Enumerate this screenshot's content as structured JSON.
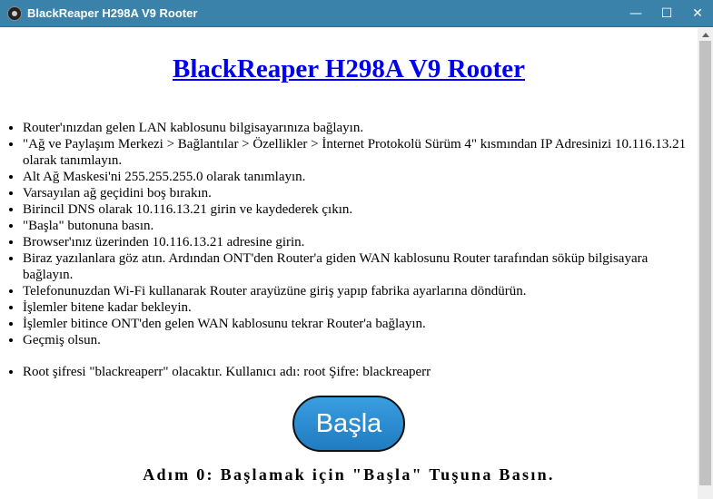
{
  "window": {
    "title": "BlackReaper H298A V9 Rooter",
    "minimize_glyph": "—",
    "maximize_glyph": "☐",
    "close_glyph": "✕"
  },
  "page": {
    "heading": "BlackReaper H298A V9 Rooter",
    "steps": [
      "Router'ınızdan gelen LAN kablosunu bilgisayarınıza bağlayın.",
      "\"Ağ ve Paylaşım Merkezi > Bağlantılar > Özellikler > İnternet Protokolü Sürüm 4\" kısmından IP Adresinizi 10.116.13.21 olarak tanımlayın.",
      "Alt Ağ Maskesi'ni 255.255.255.0 olarak tanımlayın.",
      "Varsayılan ağ geçidini boş bırakın.",
      "Birincil DNS olarak 10.116.13.21 girin ve kaydederek çıkın.",
      "\"Başla\" butonuna basın.",
      "Browser'ınız üzerinden 10.116.13.21 adresine girin.",
      "Biraz yazılanlara göz atın. Ardından ONT'den Router'a giden WAN kablosunu Router tarafından söküp bilgisayara bağlayın.",
      "Telefonunuzdan Wi-Fi kullanarak Router arayüzüne giriş yapıp fabrika ayarlarına döndürün.",
      "İşlemler bitene kadar bekleyin.",
      "İşlemler bitince ONT'den gelen WAN kablosunu tekrar Router'a bağlayın.",
      "Geçmiş olsun."
    ],
    "note": "Root şifresi \"blackreaperr\" olacaktır. Kullanıcı adı: root Şifre: blackreaperr",
    "start_button": "Başla",
    "status_message": "Adım 0: Başlamak için \"Başla\" Tuşuna Basın."
  },
  "colors": {
    "titlebar": "#3a82aa",
    "link": "#0000ee",
    "button": "#2a8bd0"
  },
  "icons": [
    "app-icon",
    "minimize-icon",
    "maximize-icon",
    "close-icon",
    "scroll-up-arrow-icon"
  ]
}
